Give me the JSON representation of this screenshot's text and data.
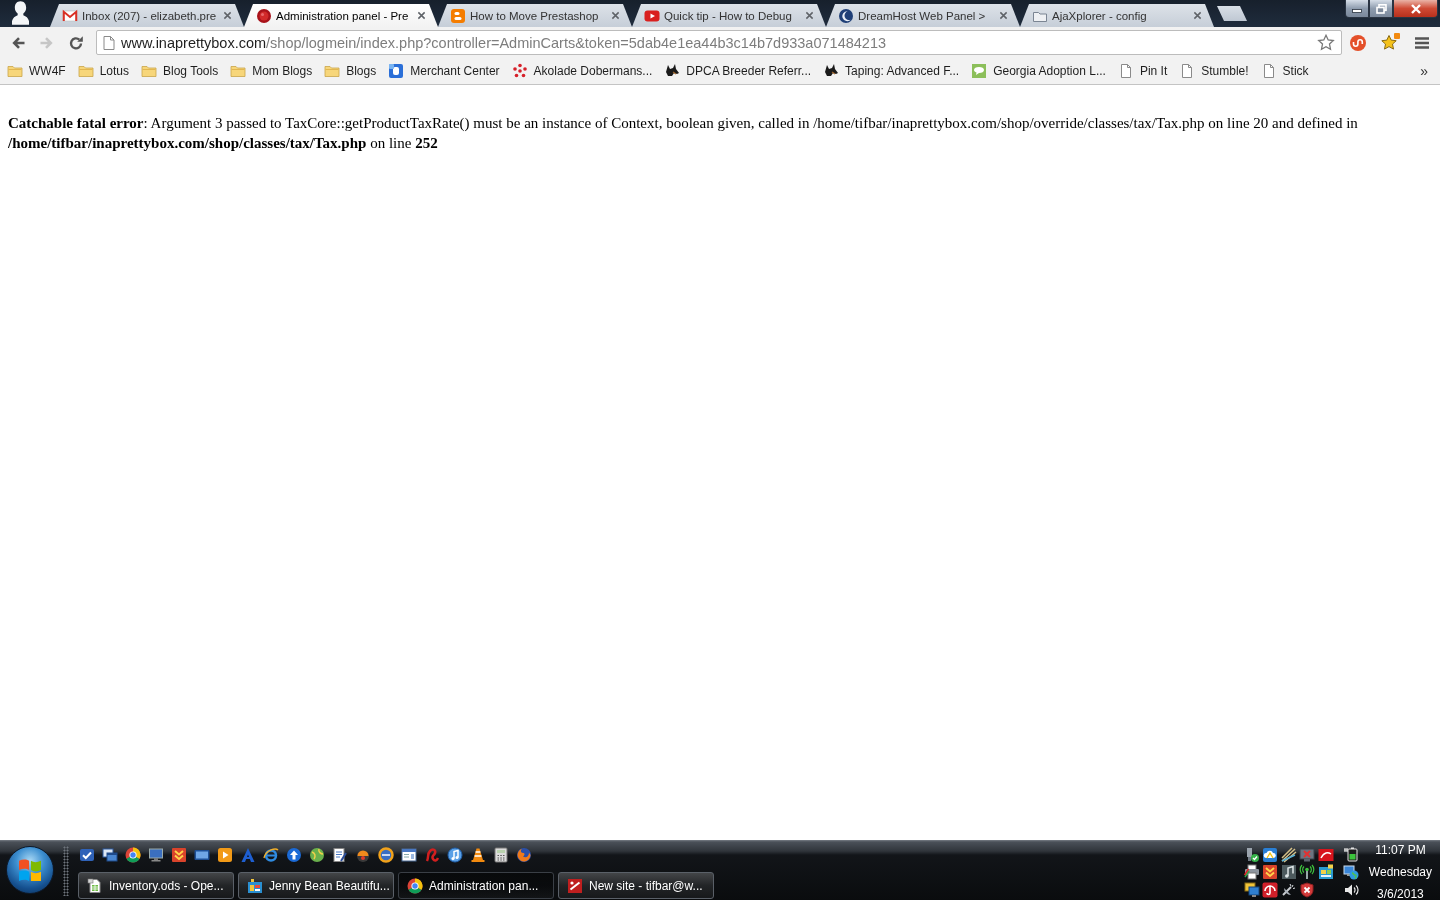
{
  "browser": {
    "tabs": [
      {
        "title": "Inbox (207) - elizabeth.pre",
        "selected": false
      },
      {
        "title": "Administration panel - Pre",
        "selected": true
      },
      {
        "title": "How to Move Prestashop",
        "selected": false
      },
      {
        "title": "Quick tip - How to Debug",
        "selected": false
      },
      {
        "title": "DreamHost Web Panel >",
        "selected": false
      },
      {
        "title": "AjaXplorer - config",
        "selected": false
      }
    ],
    "toolbar": {
      "nav_buttons": [
        {
          "kind": "back",
          "disabled": false
        },
        {
          "kind": "forward",
          "disabled": true
        },
        {
          "kind": "reload",
          "disabled": false
        }
      ],
      "address": {
        "host": "www.inaprettybox.com",
        "path": "/shop/logmein/index.php?controller=AdminCarts&token=5dab4e1ea44b3c14b7d933a071484213"
      }
    },
    "bookmarks": [
      {
        "label": "WW4F",
        "kind": "folder"
      },
      {
        "label": "Lotus",
        "kind": "folder"
      },
      {
        "label": "Blog Tools",
        "kind": "folder"
      },
      {
        "label": "Mom Blogs",
        "kind": "folder"
      },
      {
        "label": "Blogs",
        "kind": "folder"
      },
      {
        "label": "Merchant Center",
        "kind": "site"
      },
      {
        "label": "Akolade Dobermans...",
        "kind": "site"
      },
      {
        "label": "DPCA Breeder Referr...",
        "kind": "site"
      },
      {
        "label": "Taping: Advanced F...",
        "kind": "site"
      },
      {
        "label": "Georgia Adoption L...",
        "kind": "site"
      },
      {
        "label": "Pin It",
        "kind": "page"
      },
      {
        "label": "Stumble!",
        "kind": "page"
      },
      {
        "label": "Stick",
        "kind": "page"
      }
    ],
    "bookmarks_overflow": "»"
  },
  "page": {
    "error": "**Catchable fatal error**: Argument 3 passed to TaxCore::getProductTaxRate() must be an instance of Context, boolean given, called in /home/tifbar/inaprettybox.com/shop/override/classes/tax/Tax.php on line 20 and defined in **/home/tifbar/inaprettybox.com/shop/classes/tax/Tax.php** on line **252**"
  },
  "taskbar": {
    "tasks": [
      {
        "label": "Inventory.ods - Ope...",
        "selected": false
      },
      {
        "label": "Jenny Bean Beautifu...",
        "selected": false
      },
      {
        "label": "Administration pan...",
        "selected": true
      },
      {
        "label": "New site - tifbar@w...",
        "selected": false
      }
    ],
    "clock": {
      "time": "11:07 PM",
      "day": "Wednesday",
      "date": "3/6/2013"
    }
  }
}
